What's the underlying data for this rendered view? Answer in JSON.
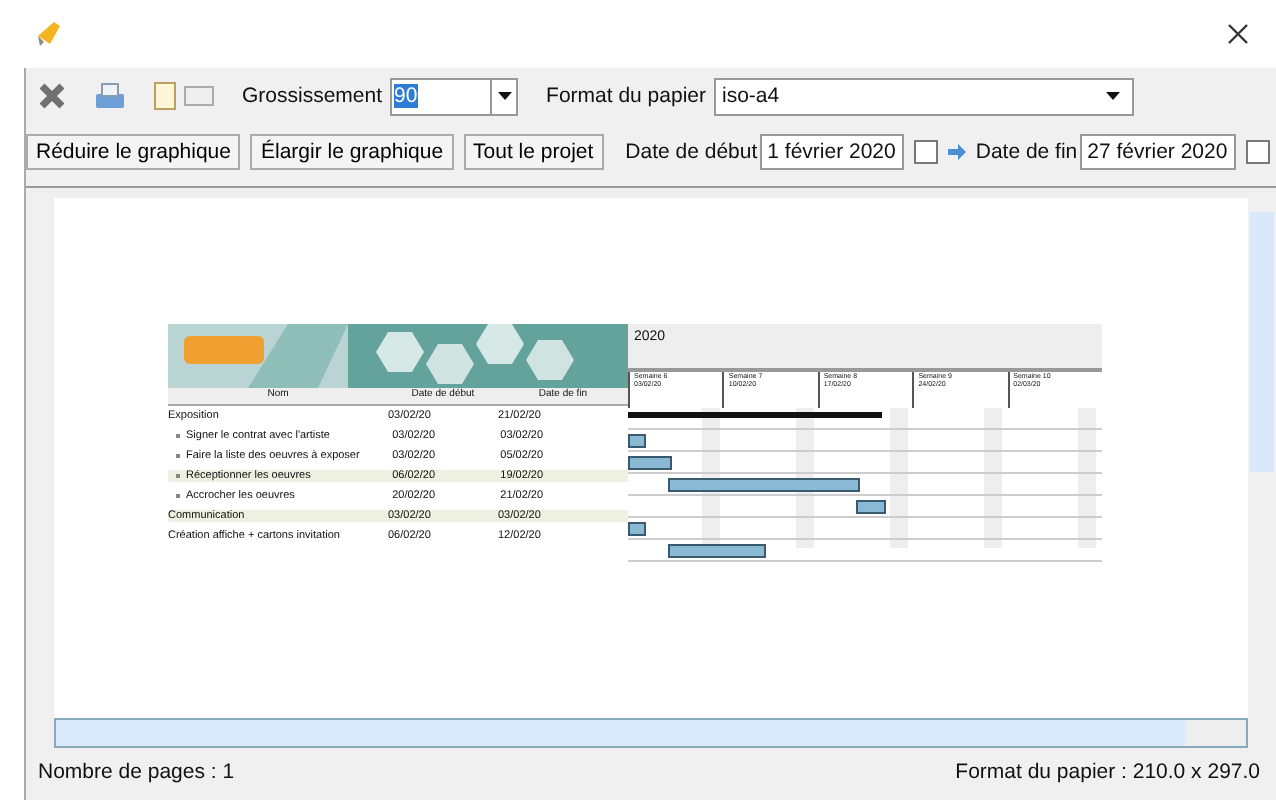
{
  "toolbar": {
    "zoom_label": "Grossissement",
    "zoom_value": "90",
    "paper_label": "Format du papier",
    "paper_value": "iso-a4"
  },
  "buttons": [
    "Réduire le graphique",
    "Élargir le graphique",
    "Tout le projet"
  ],
  "dates": {
    "start_label": "Date de début",
    "start_value": "1 février 2020",
    "end_label": "Date de fin",
    "end_value": "27 février 2020"
  },
  "preview": {
    "year": "2020",
    "columns": [
      "Nom",
      "Date de début",
      "Date de fin"
    ],
    "weeks": [
      {
        "name": "Semaine 6",
        "date": "03/02/20"
      },
      {
        "name": "Semaine 7",
        "date": "10/02/20"
      },
      {
        "name": "Semaine 8",
        "date": "17/02/20"
      },
      {
        "name": "Semaine 9",
        "date": "24/02/20"
      },
      {
        "name": "Semaine 10",
        "date": "02/03/20"
      }
    ],
    "tasks": [
      {
        "name": "Exposition",
        "start": "03/02/20",
        "end": "21/02/20",
        "kind": "summary",
        "sub": false,
        "highlight": false
      },
      {
        "name": "Signer le contrat avec l'artiste",
        "start": "03/02/20",
        "end": "03/02/20",
        "kind": "task",
        "sub": true,
        "highlight": false
      },
      {
        "name": "Faire la liste des oeuvres à exposer",
        "start": "03/02/20",
        "end": "05/02/20",
        "kind": "task",
        "sub": true,
        "highlight": false
      },
      {
        "name": "Réceptionner les oeuvres",
        "start": "06/02/20",
        "end": "19/02/20",
        "kind": "task",
        "sub": true,
        "highlight": true
      },
      {
        "name": "Accrocher les oeuvres",
        "start": "20/02/20",
        "end": "21/02/20",
        "kind": "task",
        "sub": true,
        "highlight": false
      },
      {
        "name": "Communication",
        "start": "03/02/20",
        "end": "03/02/20",
        "kind": "task",
        "sub": false,
        "highlight": true
      },
      {
        "name": "Création affiche + cartons invitation",
        "start": "06/02/20",
        "end": "12/02/20",
        "kind": "task",
        "sub": false,
        "highlight": false
      }
    ]
  },
  "status": {
    "pages": "Nombre de pages : 1",
    "paper": "Format du papier : 210.0 x 297.0"
  }
}
